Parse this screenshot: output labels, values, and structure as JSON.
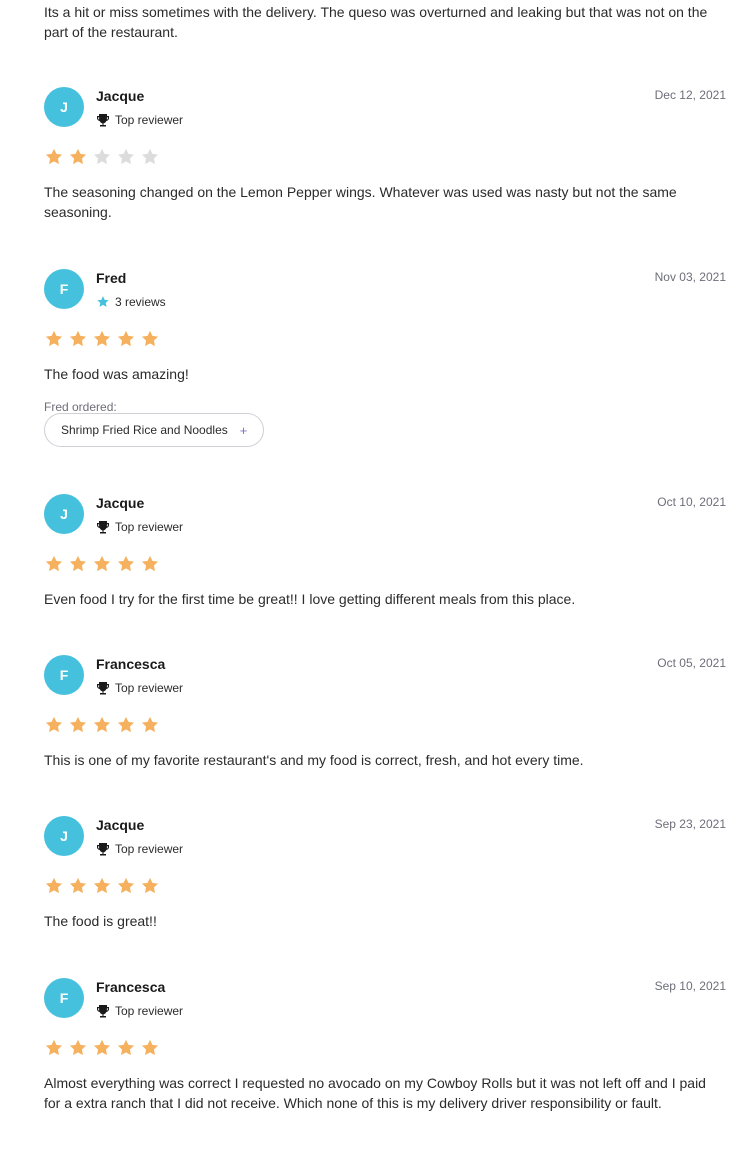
{
  "top_text": "Its a hit or miss sometimes with the delivery. The queso was overturned and leaking but that was not on the part of the restaurant.",
  "reviews": [
    {
      "initial": "J",
      "name": "Jacque",
      "date": "Dec 12, 2021",
      "badge": "Top reviewer",
      "badge_icon": "trophy-icon",
      "rating": 2,
      "text": "The seasoning changed on the Lemon Pepper wings. Whatever was used was nasty but not the same seasoning."
    },
    {
      "initial": "F",
      "name": "Fred",
      "date": "Nov 03, 2021",
      "badge": "3 reviews",
      "badge_icon": "star-icon",
      "rating": 5,
      "text": "The food was amazing!",
      "ordered_label": "Fred ordered:",
      "ordered_item": "Shrimp Fried Rice and Noodles",
      "ordered_action": "+"
    },
    {
      "initial": "J",
      "name": "Jacque",
      "date": "Oct 10, 2021",
      "badge": "Top reviewer",
      "badge_icon": "trophy-icon",
      "rating": 5,
      "text": "Even food I try for the first time be great!! I love getting different meals from this place."
    },
    {
      "initial": "F",
      "name": "Francesca",
      "date": "Oct 05, 2021",
      "badge": "Top reviewer",
      "badge_icon": "trophy-icon",
      "rating": 5,
      "text": "This is one of my favorite restaurant's and my food is correct, fresh, and hot every time."
    },
    {
      "initial": "J",
      "name": "Jacque",
      "date": "Sep 23, 2021",
      "badge": "Top reviewer",
      "badge_icon": "trophy-icon",
      "rating": 5,
      "text": "The food is great!!"
    },
    {
      "initial": "F",
      "name": "Francesca",
      "date": "Sep 10, 2021",
      "badge": "Top reviewer",
      "badge_icon": "trophy-icon",
      "rating": 5,
      "text": "Almost everything was correct I requested no avocado on my Cowboy Rolls but it was not left off and I paid for a extra ranch that I did not receive. Which none of this is my delivery driver responsibility or fault."
    }
  ],
  "colors": {
    "avatar_bg": "#45c1de",
    "star_filled": "#f6b15f",
    "star_empty": "#dcdcdc",
    "muted_text": "#6e6e7a"
  }
}
